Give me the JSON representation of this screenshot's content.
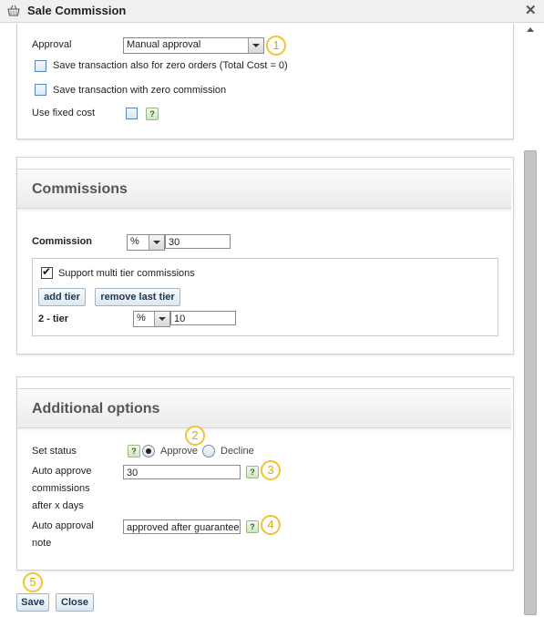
{
  "dialog": {
    "title": "Sale Commission",
    "close": "✕"
  },
  "general": {
    "approval_label": "Approval",
    "approval_value": "Manual approval",
    "zero_orders_label": "Save transaction also for zero orders (Total Cost = 0)",
    "zero_commission_label": "Save transaction with zero commission",
    "fixed_cost_label": "Use fixed cost",
    "help_glyph": "?"
  },
  "commissions": {
    "heading": "Commissions",
    "commission_label": "Commission",
    "commission_type": "%",
    "commission_value": "30",
    "multi_tier_label": "Support multi tier commissions",
    "multi_tier_checked": true,
    "add_tier": "add tier",
    "remove_tier": "remove last tier",
    "tier_label": "2 - tier",
    "tier_type": "%",
    "tier_value": "10"
  },
  "additional": {
    "heading": "Additional options",
    "set_status_label": "Set status",
    "approve_label": "Approve",
    "decline_label": "Decline",
    "approve_selected": true,
    "auto_approve_label_1": "Auto approve",
    "auto_approve_label_2": "commissions",
    "auto_approve_label_3": "after x days",
    "auto_approve_value": "30",
    "approval_note_label_1": "Auto approval",
    "approval_note_label_2": "note",
    "approval_note_value": "approved after guarantee"
  },
  "footer": {
    "save": "Save",
    "close": "Close"
  },
  "badges": [
    "1",
    "2",
    "3",
    "4",
    "5"
  ],
  "colors": {
    "badge_accent": "#f0c330",
    "help_green": "#2d6a14",
    "button_text": "#1f3550"
  }
}
